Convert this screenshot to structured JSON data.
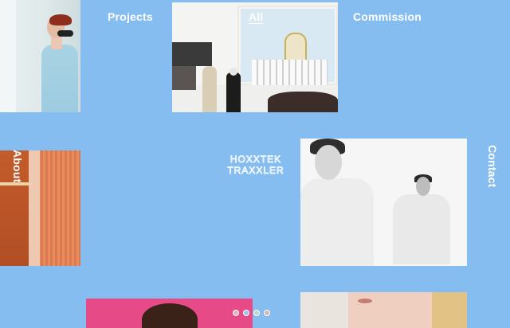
{
  "nav": {
    "projects": "Projects",
    "all": "All",
    "commission": "Commission",
    "about": "About",
    "contact": "Contact"
  },
  "logo": {
    "line1": "HOXXTEK",
    "line2": "TRAXXLER"
  },
  "colors": {
    "background": "#86bdf0",
    "nav_text": "#ffffff",
    "dots": [
      "#e6b3c0",
      "#9ec6ec",
      "#b7d9c9",
      "#d7b7b1"
    ]
  },
  "pagination": {
    "count": 4
  }
}
